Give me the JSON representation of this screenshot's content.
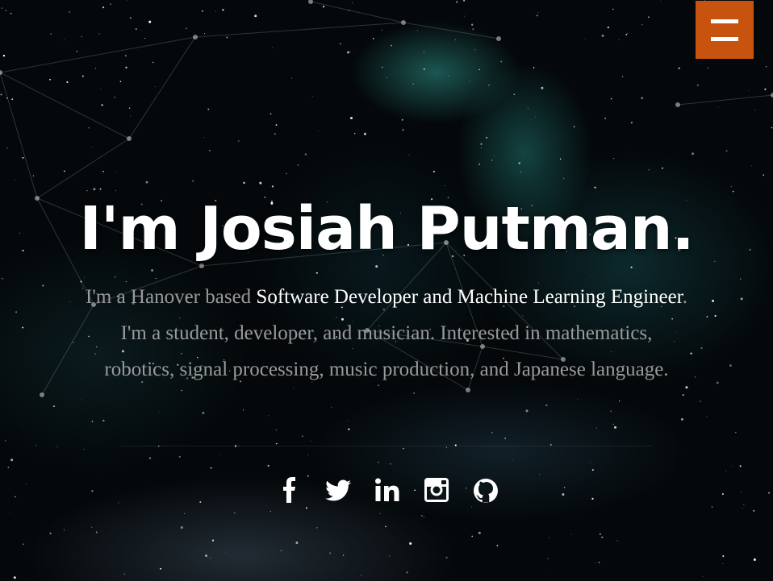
{
  "nav": {
    "menu_icon": "hamburger-icon",
    "menu_color": "#c8530f"
  },
  "hero": {
    "headline": "I'm Josiah Putman.",
    "intro": {
      "part1": "I'm a Hanover based ",
      "highlight1": "Software Developer and Machine Learning Engineer",
      "part2": ". I'm a student, developer, and musician. Interested in mathematics, robotics, signal processing, music production, and Japanese language."
    }
  },
  "social": [
    {
      "name": "facebook",
      "icon": "facebook-icon"
    },
    {
      "name": "twitter",
      "icon": "twitter-icon"
    },
    {
      "name": "linkedin",
      "icon": "linkedin-icon"
    },
    {
      "name": "instagram",
      "icon": "instagram-icon"
    },
    {
      "name": "github",
      "icon": "github-icon"
    }
  ],
  "colors": {
    "accent": "#c8530f",
    "text": "#ffffff",
    "muted_text": "#9a9a9a"
  }
}
